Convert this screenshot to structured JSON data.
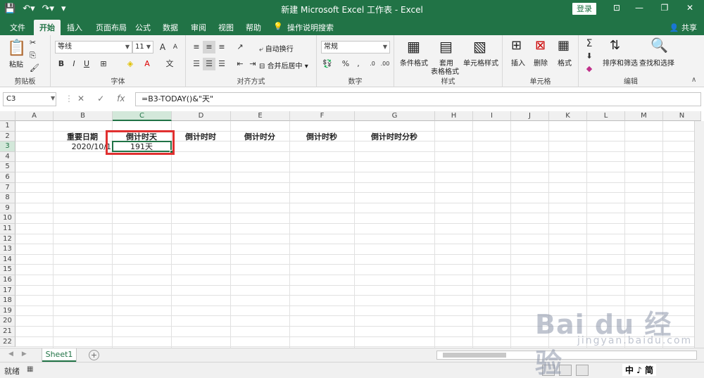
{
  "window": {
    "title": "新建 Microsoft Excel 工作表  -  Excel",
    "login_label": "登录"
  },
  "tabs": [
    "文件",
    "开始",
    "插入",
    "页面布局",
    "公式",
    "数据",
    "审阅",
    "视图",
    "帮助",
    "操作说明搜索"
  ],
  "active_tab": "开始",
  "share_label": "共享",
  "ribbon": {
    "clipboard": {
      "paste_label": "粘贴",
      "group_label": "剪贴板"
    },
    "font": {
      "font_name": "等线",
      "font_size": "11",
      "bold": "B",
      "italic": "I",
      "underline": "U",
      "group_label": "字体",
      "inc": "A",
      "dec": "A"
    },
    "alignment": {
      "wrap_label": "自动换行",
      "merge_label": "合并后居中",
      "group_label": "对齐方式"
    },
    "number": {
      "format": "常规",
      "group_label": "数字",
      "percent": "%",
      "comma": ","
    },
    "styles": {
      "cond_label": "条件格式",
      "table_label_1": "套用",
      "table_label_2": "表格格式",
      "cell_style_label": "单元格样式",
      "group_label": "样式"
    },
    "cells": {
      "insert_label": "插入",
      "delete_label": "删除",
      "format_label": "格式",
      "group_label": "单元格"
    },
    "editing": {
      "sort_label": "排序和筛选",
      "find_label": "查找和选择",
      "group_label": "编辑",
      "sum_symbol": "Σ"
    }
  },
  "formula_bar": {
    "name_box": "C3",
    "formula": "=B3-TODAY()&\"天\"",
    "fx_label": "fx"
  },
  "grid": {
    "columns": [
      "A",
      "B",
      "C",
      "D",
      "E",
      "F",
      "G",
      "H",
      "I",
      "J",
      "K",
      "L",
      "M",
      "N"
    ],
    "rows": [
      "1",
      "2",
      "3",
      "4",
      "5",
      "6",
      "7",
      "8",
      "9",
      "10",
      "11",
      "12",
      "13",
      "14",
      "15",
      "16",
      "17",
      "18",
      "19",
      "20",
      "21",
      "22"
    ],
    "selected_column": "C",
    "selected_row": "3",
    "cells": {
      "B2": "重要日期",
      "C2": "倒计时天",
      "D2": "倒计时时",
      "E2": "倒计时分",
      "F2": "倒计时秒",
      "G2": "倒计时时分秒",
      "B3": "2020/10/1",
      "C3": "191天"
    }
  },
  "sheets": {
    "active": "Sheet1",
    "add_label": "+"
  },
  "status": {
    "ready": "就绪"
  },
  "ime": "中 ♪ 简",
  "watermark": {
    "brand": "Bai du 经验",
    "url": "jingyan.baidu.com"
  },
  "colors": {
    "excel_green": "#217346",
    "highlight_red": "#e03030"
  }
}
